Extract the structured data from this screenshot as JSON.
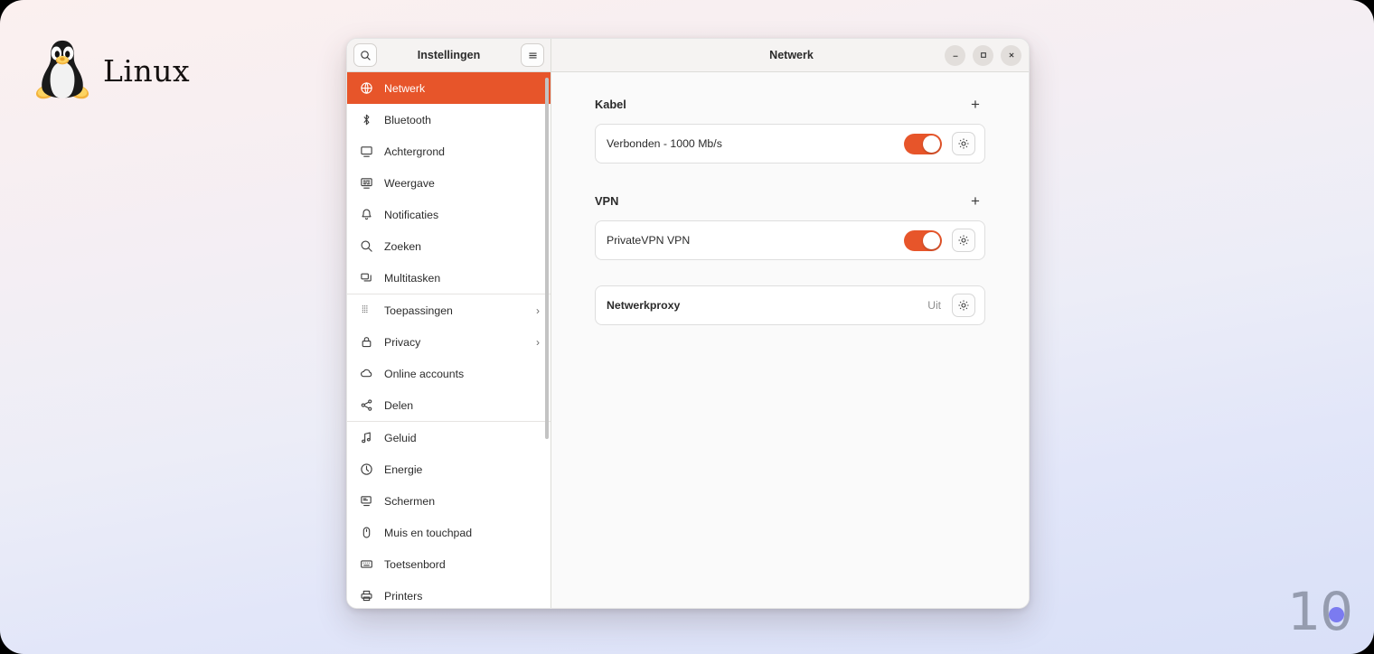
{
  "desktop": {
    "brand_name": "Linux",
    "brand_logo_icon": "tux-penguin-icon",
    "watermark_text": "10"
  },
  "colors": {
    "accent": "#e7552a",
    "sidebar_bg": "#ffffff",
    "header_bg": "#f5f3f2",
    "content_bg": "#fafafa",
    "watermark_dot": "#7b7bf0"
  },
  "sidebar": {
    "title": "Instellingen",
    "search_icon": "search-icon",
    "menu_icon": "hamburger-menu-icon",
    "items": [
      {
        "label": "Netwerk",
        "icon": "globe-icon",
        "selected": true,
        "chevron": false,
        "sep_after": false
      },
      {
        "label": "Bluetooth",
        "icon": "bluetooth-icon",
        "selected": false,
        "chevron": false,
        "sep_after": false
      },
      {
        "label": "Achtergrond",
        "icon": "wallpaper-icon",
        "selected": false,
        "chevron": false,
        "sep_after": false
      },
      {
        "label": "Weergave",
        "icon": "display-icon",
        "selected": false,
        "chevron": false,
        "sep_after": false
      },
      {
        "label": "Notificaties",
        "icon": "bell-icon",
        "selected": false,
        "chevron": false,
        "sep_after": false
      },
      {
        "label": "Zoeken",
        "icon": "search-icon",
        "selected": false,
        "chevron": false,
        "sep_after": false
      },
      {
        "label": "Multitasken",
        "icon": "windows-icon",
        "selected": false,
        "chevron": false,
        "sep_after": true
      },
      {
        "label": "Toepassingen",
        "icon": "grid-dots-icon",
        "selected": false,
        "chevron": true,
        "sep_after": false
      },
      {
        "label": "Privacy",
        "icon": "lock-icon",
        "selected": false,
        "chevron": true,
        "sep_after": false
      },
      {
        "label": "Online accounts",
        "icon": "cloud-icon",
        "selected": false,
        "chevron": false,
        "sep_after": false
      },
      {
        "label": "Delen",
        "icon": "share-icon",
        "selected": false,
        "chevron": false,
        "sep_after": true
      },
      {
        "label": "Geluid",
        "icon": "music-note-icon",
        "selected": false,
        "chevron": false,
        "sep_after": false
      },
      {
        "label": "Energie",
        "icon": "power-icon",
        "selected": false,
        "chevron": false,
        "sep_after": false
      },
      {
        "label": "Schermen",
        "icon": "monitor-icon",
        "selected": false,
        "chevron": false,
        "sep_after": false
      },
      {
        "label": "Muis en touchpad",
        "icon": "mouse-icon",
        "selected": false,
        "chevron": false,
        "sep_after": false
      },
      {
        "label": "Toetsenbord",
        "icon": "keyboard-icon",
        "selected": false,
        "chevron": false,
        "sep_after": false
      },
      {
        "label": "Printers",
        "icon": "printer-icon",
        "selected": false,
        "chevron": false,
        "sep_after": false
      }
    ]
  },
  "window": {
    "title": "Netwerk",
    "minimize_icon": "minimize-icon",
    "maximize_icon": "maximize-icon",
    "close_icon": "close-icon"
  },
  "main": {
    "sections": [
      {
        "heading": "Kabel",
        "add_icon": "plus-icon",
        "row": {
          "label": "Verbonden - 1000 Mb/s",
          "bold": false,
          "has_toggle": true,
          "toggle_on": true,
          "state_text": "",
          "settings_icon": "gear-icon"
        }
      },
      {
        "heading": "VPN",
        "add_icon": "plus-icon",
        "row": {
          "label": "PrivateVPN VPN",
          "bold": false,
          "has_toggle": true,
          "toggle_on": true,
          "state_text": "",
          "settings_icon": "gear-icon"
        }
      }
    ],
    "proxy": {
      "label": "Netwerkproxy",
      "bold": true,
      "has_toggle": false,
      "state_text": "Uit",
      "settings_icon": "gear-icon"
    }
  }
}
